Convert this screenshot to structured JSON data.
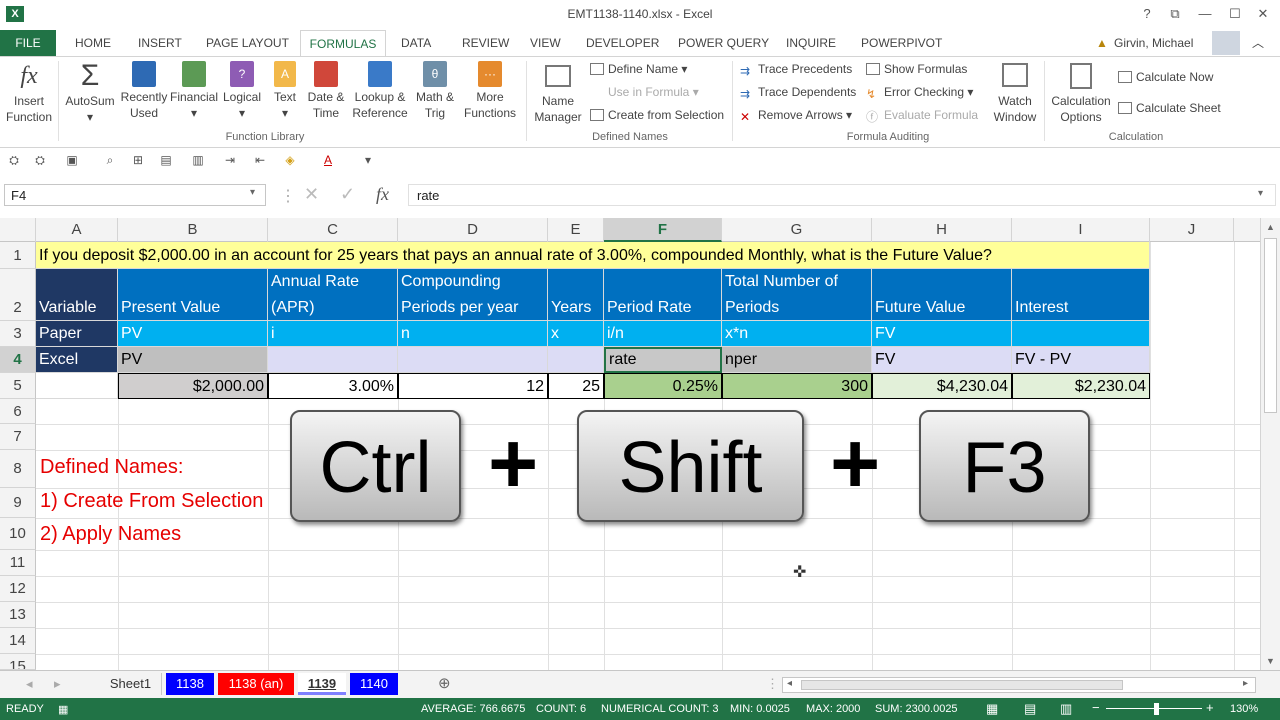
{
  "window": {
    "title": "EMT1138-1140.xlsx - Excel",
    "app_icon": "X",
    "help": "?",
    "restore_ribbon": "⧉",
    "minimize": "—",
    "maximize": "☐",
    "close": "✕"
  },
  "tabs": [
    "FILE",
    "HOME",
    "INSERT",
    "PAGE LAYOUT",
    "FORMULAS",
    "DATA",
    "REVIEW",
    "VIEW",
    "DEVELOPER",
    "POWER QUERY",
    "INQUIRE",
    "POWERPIVOT"
  ],
  "user": "Girvin, Michael",
  "ribbon": {
    "insert_function": [
      "Insert",
      "Function"
    ],
    "autosum": "AutoSum",
    "recently_used": [
      "Recently",
      "Used"
    ],
    "financial": "Financial",
    "logical": "Logical",
    "text": "Text",
    "date_time": [
      "Date &",
      "Time"
    ],
    "lookup": [
      "Lookup &",
      "Reference"
    ],
    "math": [
      "Math &",
      "Trig"
    ],
    "more": [
      "More",
      "Functions"
    ],
    "function_library": "Function Library",
    "name_manager": [
      "Name",
      "Manager"
    ],
    "define_name": "Define Name",
    "use_in_formula": "Use in Formula",
    "create_from_selection": "Create from Selection",
    "defined_names": "Defined Names",
    "trace_precedents": "Trace Precedents",
    "trace_dependents": "Trace Dependents",
    "remove_arrows": "Remove Arrows",
    "show_formulas": "Show Formulas",
    "error_checking": "Error Checking",
    "evaluate_formula": "Evaluate Formula",
    "watch_window": [
      "Watch",
      "Window"
    ],
    "formula_auditing": "Formula Auditing",
    "calc_options": [
      "Calculation",
      "Options"
    ],
    "calculate_now": "Calculate Now",
    "calculate_sheet": "Calculate Sheet",
    "calculation": "Calculation",
    "fx_icon": "fx",
    "sigma_icon": "Σ",
    "theta_icon": "θ",
    "more_icon": "···"
  },
  "formula_bar": {
    "name_box": "F4",
    "formula": "rate",
    "fx": "fx"
  },
  "columns": [
    "A",
    "B",
    "C",
    "D",
    "E",
    "F",
    "G",
    "H",
    "I",
    "J"
  ],
  "rows": [
    "1",
    "2",
    "3",
    "4",
    "5",
    "6",
    "7",
    "8",
    "9",
    "10",
    "11",
    "12",
    "13",
    "14",
    "15"
  ],
  "sheet": {
    "r1": "If you deposit $2,000.00 in an account for 25 years that pays an annual rate of 3.00%, compounded Monthly, what is the Future Value?",
    "r2": {
      "A": "Variable",
      "B": "Present Value",
      "C1": "Annual Rate",
      "C2": "(APR)",
      "D1": "Compounding",
      "D2": "Periods per year",
      "E": "Years",
      "F": "Period Rate",
      "G1": "Total Number of",
      "G2": "Periods",
      "H": "Future Value",
      "I": "Interest"
    },
    "r3": {
      "A": "Paper",
      "B": "PV",
      "C": "i",
      "D": "n",
      "E": "x",
      "F": "i/n",
      "G": "x*n",
      "H": "FV",
      "I": ""
    },
    "r4": {
      "A": "Excel",
      "B": "PV",
      "C": "",
      "D": "",
      "E": "",
      "F": "rate",
      "G": "nper",
      "H": "FV",
      "I": "FV - PV"
    },
    "r5": {
      "A": "",
      "B": "$2,000.00",
      "C": "3.00%",
      "D": "12",
      "E": "25",
      "F": "0.25%",
      "G": "300",
      "H": "$4,230.04",
      "I": "$2,230.04"
    },
    "notes": [
      "Defined Names:",
      "1) Create From Selection",
      "2) Apply Names"
    ]
  },
  "keys": {
    "k1": "Ctrl",
    "plus": "+",
    "k2": "Shift",
    "k3": "F3"
  },
  "sheet_tabs": [
    "Sheet1",
    "1138",
    "1138 (an)",
    "1139",
    "1140"
  ],
  "sheet_tab_colors": {
    "1138": "#0000ff",
    "1138 (an)": "#ff0000",
    "1140": "#0000ff"
  },
  "status": {
    "ready": "READY",
    "average": "AVERAGE: 766.6675",
    "count": "COUNT: 6",
    "numerical_count": "NUMERICAL COUNT: 3",
    "min": "MIN: 0.0025",
    "max": "MAX: 2000",
    "sum": "SUM: 2300.0025",
    "zoom": "130%"
  }
}
